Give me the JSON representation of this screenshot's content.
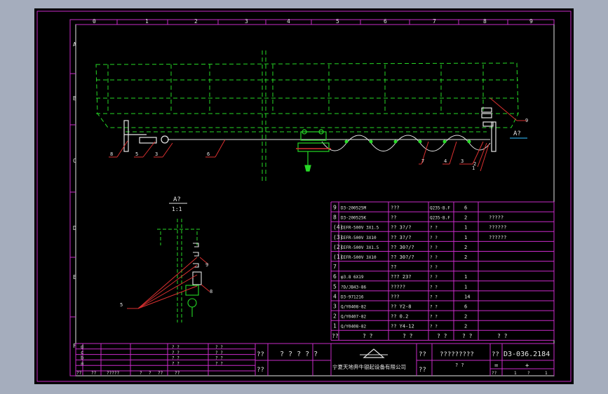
{
  "colors": {
    "background": "#a5adbd",
    "paper": "#000000",
    "frame": "#c92bc9",
    "ink": "#e6e6e6",
    "hidden": "#26d926",
    "accent": "#2a9fd6",
    "marker": "#d93030"
  },
  "column_labels": [
    "0",
    "1",
    "2",
    "3",
    "4",
    "5",
    "6",
    "7",
    "8",
    "9"
  ],
  "row_labels": [
    "A",
    "B",
    "C",
    "D",
    "E",
    "F"
  ],
  "view_label": {
    "name": "A?",
    "scale": "1:1"
  },
  "section_marker": "A?",
  "main_callouts": [
    "8",
    "5",
    "3",
    "6",
    "7",
    "4",
    "3",
    "2",
    "1",
    "9"
  ],
  "side_callouts": [
    "9",
    "8",
    "5"
  ],
  "bom": [
    {
      "no": "9",
      "code": "D3-200525M",
      "name": "???",
      "material": "Q235-B.F",
      "qty": "6",
      "note": ""
    },
    {
      "no": "8",
      "code": "D3-200525K",
      "name": "??",
      "material": "Q235-B.F",
      "qty": "2",
      "note": "?????"
    },
    {
      "no": "(4)",
      "code": "CEFR-500V 3X1.5",
      "name": "??  3?/?",
      "material": "? ?",
      "qty": "1",
      "note": "??????"
    },
    {
      "no": "(3)",
      "code": "CEFR-500V 3X10",
      "name": "??  3?/?",
      "material": "? ?",
      "qty": "1",
      "note": "??????"
    },
    {
      "no": "(2)",
      "code": "CEFR-500V 3X1.5",
      "name": "??  30?/?",
      "material": "? ?",
      "qty": "2",
      "note": ""
    },
    {
      "no": "(1)",
      "code": "CEFR-500V 3X10",
      "name": "??  30?/?",
      "material": "? ?",
      "qty": "2",
      "note": ""
    },
    {
      "no": "7",
      "code": "",
      "name": "??",
      "material": "? ?",
      "qty": "",
      "note": ""
    },
    {
      "no": "6",
      "code": "φ3.8  6X19",
      "name": "???  23?",
      "material": "? ?",
      "qty": "1",
      "note": ""
    },
    {
      "no": "5",
      "code": "?D/JB43-86",
      "name": "?????",
      "material": "? ?",
      "qty": "1",
      "note": ""
    },
    {
      "no": "4",
      "code": "D3-971216",
      "name": "???",
      "material": "? ?",
      "qty": "14",
      "note": ""
    },
    {
      "no": "3",
      "code": "Q/Y0408-82",
      "name": "??  Y2-8",
      "material": "? ?",
      "qty": "6",
      "note": ""
    },
    {
      "no": "2",
      "code": "Q/Y0407-82",
      "name": "??  0.2",
      "material": "? ?",
      "qty": "2",
      "note": ""
    },
    {
      "no": "1",
      "code": "Q/Y0408-82",
      "name": "??  Y4-12",
      "material": "? ?",
      "qty": "2",
      "note": ""
    }
  ],
  "bom_header": [
    "??",
    "?  ?",
    "?  ?",
    "?  ?",
    "?  ?",
    "?  ?"
  ],
  "title_block": {
    "rev_letters": [
      "d",
      "c",
      "b",
      "a"
    ],
    "rev_cells": [
      "? ?",
      "? ?",
      "? ?",
      "? ?"
    ],
    "rev_cells2": [
      "? ?",
      "? ?",
      "? ?",
      "? ?"
    ],
    "bottom_labels": [
      "??",
      "??",
      "?????",
      "?",
      "?",
      "??",
      "??"
    ],
    "tb_left1": "??",
    "tb_left2": "??",
    "title": "? ? ? ? ?",
    "company": "宁夏天地奔牛银起设备有限公司",
    "right_label1": "??",
    "right_label2": "??",
    "name_text": "?????????",
    "right_small": "? ?",
    "dwg_label": "??",
    "dwg_no": "D3-036.2184",
    "scale_mark": "=",
    "sheet_mark": "+",
    "sheet_a": "??",
    "sheet_b": "1",
    "sheet_c": "?",
    "sheet_d": "1"
  }
}
